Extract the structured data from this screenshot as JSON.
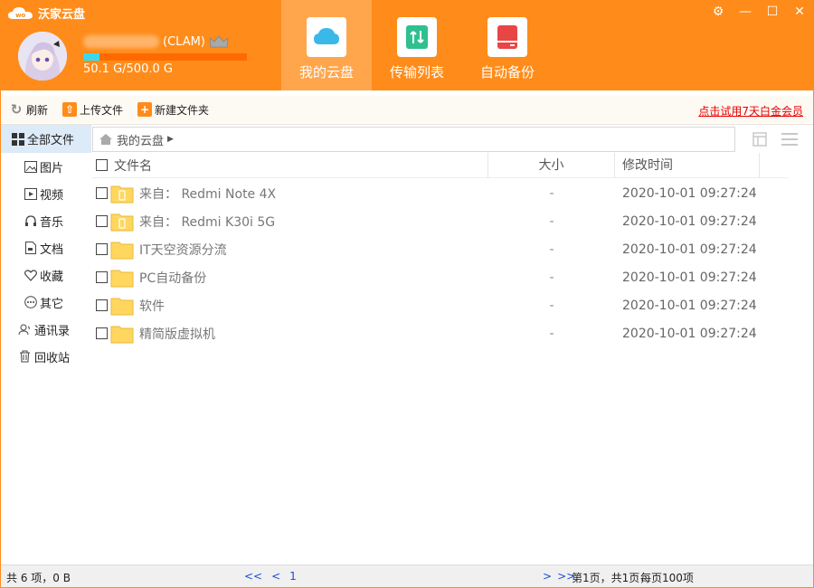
{
  "app": {
    "title": "沃家云盘",
    "accent": "#ff8c1a"
  },
  "user": {
    "level": "(CLAM)",
    "quota_text": "50.1 G/500.0 G",
    "quota_fraction": 0.1
  },
  "nav": {
    "tabs": [
      {
        "label": "我的云盘",
        "icon": "cloud-icon",
        "active": true
      },
      {
        "label": "传输列表",
        "icon": "transfer-icon",
        "active": false
      },
      {
        "label": "自动备份",
        "icon": "backup-icon",
        "active": false
      }
    ]
  },
  "toolbar": {
    "refresh": "刷新",
    "upload": "上传文件",
    "new_folder": "新建文件夹",
    "promo": "点击试用7天白金会员"
  },
  "sidebar": {
    "items": [
      {
        "label": "全部文件",
        "icon": "grid-icon"
      },
      {
        "label": "图片",
        "icon": "image-icon"
      },
      {
        "label": "视频",
        "icon": "video-icon"
      },
      {
        "label": "音乐",
        "icon": "headphones-icon"
      },
      {
        "label": "文档",
        "icon": "document-icon"
      },
      {
        "label": "收藏",
        "icon": "heart-icon"
      },
      {
        "label": "其它",
        "icon": "more-icon"
      },
      {
        "label": "通讯录",
        "icon": "contacts-icon"
      },
      {
        "label": "回收站",
        "icon": "trash-icon"
      }
    ]
  },
  "breadcrumb": {
    "current": "我的云盘"
  },
  "table": {
    "headers": {
      "name": "文件名",
      "size": "大小",
      "time": "修改时间"
    },
    "rows": [
      {
        "name": "来自：  Redmi Note 4X",
        "size": "-",
        "time": "2020-10-01 09:27:24",
        "type": "device-folder"
      },
      {
        "name": "来自：  Redmi K30i 5G",
        "size": "-",
        "time": "2020-10-01 09:27:24",
        "type": "device-folder"
      },
      {
        "name": "IT天空资源分流",
        "size": "-",
        "time": "2020-10-01 09:27:24",
        "type": "folder"
      },
      {
        "name": "PC自动备份",
        "size": "-",
        "time": "2020-10-01 09:27:24",
        "type": "folder"
      },
      {
        "name": "软件",
        "size": "-",
        "time": "2020-10-01 09:27:24",
        "type": "folder"
      },
      {
        "name": "精简版虚拟机",
        "size": "-",
        "time": "2020-10-01 09:27:24",
        "type": "folder"
      }
    ]
  },
  "status": {
    "count": "共 6 项，0 B",
    "first": "<<",
    "prev": "<",
    "page": "1",
    "next": ">",
    "last": ">>",
    "page_info": "第1页，共1页，",
    "page_size": "每页100项"
  }
}
